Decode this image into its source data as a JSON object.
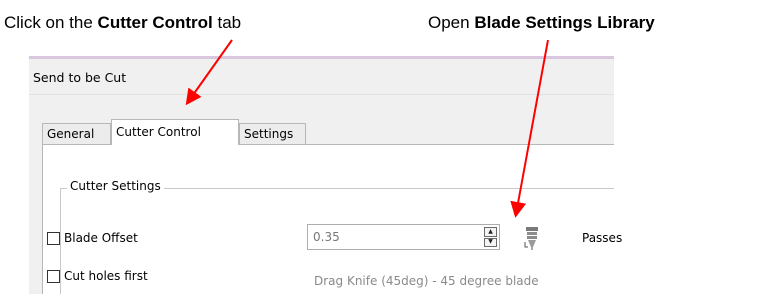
{
  "annotations": {
    "left_prefix": "Click on the ",
    "left_bold": "Cutter Control",
    "left_suffix": " tab",
    "right_prefix": "Open ",
    "right_bold": "Blade Settings Library"
  },
  "window": {
    "title": "Send to be Cut",
    "tabs": [
      {
        "label": "General",
        "active": false
      },
      {
        "label": "Cutter Control",
        "active": true
      },
      {
        "label": "Settings",
        "active": false
      }
    ]
  },
  "cutter_settings": {
    "group_label": "Cutter Settings",
    "blade_offset_label": "Blade Offset",
    "blade_offset_checked": false,
    "blade_offset_value": "0.35",
    "passes_label": "Passes",
    "cut_holes_label": "Cut holes first",
    "cut_holes_checked": false,
    "blade_description": "Drag Knife (45deg) - 45 degree blade",
    "blade_library_icon": "blade-holder-icon"
  },
  "colors": {
    "arrow": "#ff0000",
    "window_top_border": "#d9c6df"
  }
}
